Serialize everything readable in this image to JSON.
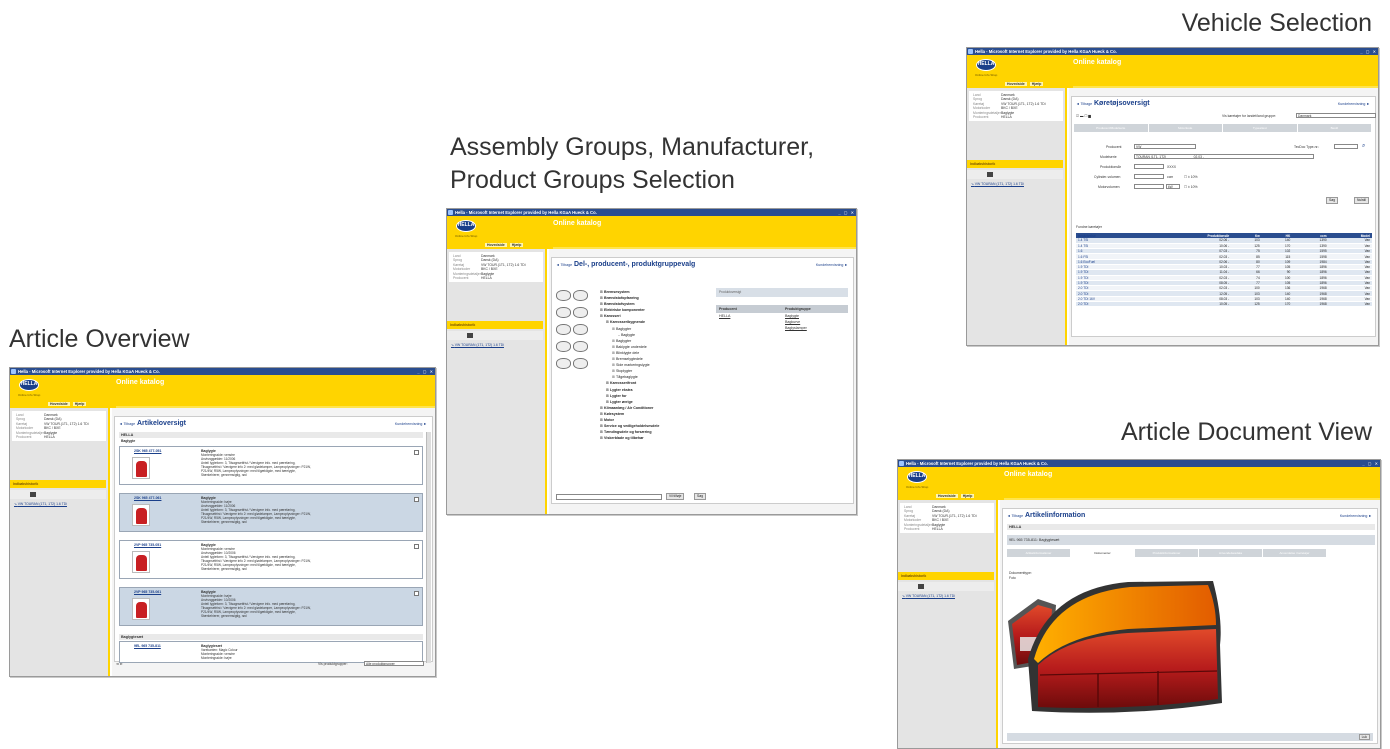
{
  "captions": {
    "vehicle": "Vehicle Selection",
    "assembly_line1": "Assembly Groups, Manufacturer,",
    "assembly_line2": "Product Groups Selection",
    "article": "Article Overview",
    "document": "Article Document View"
  },
  "common": {
    "window_title": "Hella - Microsoft Internet Explorer provided by Hella KGaA Hueck & Co.",
    "window_controls": "_ ▢ ✕",
    "logo_text": "HELLA",
    "logo_tagline": "Online Info Shop",
    "app_title": "Online katalog",
    "nav_home": "Hovedside",
    "nav_help": "Hjælp",
    "tabs": "Logning ud | Tilpasninger | Indkøbskurvoversigt | Vienhelt",
    "active_tab": "Vienhelt",
    "history_label": "Indkøbshistorik",
    "back_label": "Tilbage",
    "help_label": "Kundehenvisning",
    "context_keys": [
      "Land",
      "Sprog",
      "Køretøj",
      "Motorkoder",
      "Monteringsdetaljer",
      "Producent"
    ],
    "context_values": [
      "Danmark",
      "Dansk (DA)",
      "VW TOUR.(1T1, 1T2) 1.6 TDi",
      "BKC / BXE",
      "Baglygte",
      "HELLA"
    ],
    "history_link": "VW TOURAN (1T1, 1T2) 1.6 TDi"
  },
  "vehicle": {
    "page_title": "Køretøjsoversigt",
    "country_label": "Vis køretøjer for landet/land gruppe:",
    "country_value": "Danmark",
    "tabs": [
      "Producent/Modelserie",
      "Motorkode",
      "Typeattest",
      "Bestil"
    ],
    "producer_label": "Producent",
    "producer_value": "VW",
    "tecdoc_label": "TecDoc Type-nr.:",
    "model_label": "Modelserie",
    "model_value": "TOURAN (1T1, 1T2)",
    "model_date": "02.03 - ",
    "year_label": "Produktionsår",
    "year_value": "XXXX",
    "ccm_label": "Cylinder-volumen",
    "ccm_unit": "ccm",
    "kw_label": "Motorvolumen",
    "kw_unit": "kW",
    "tolerance": "± 10%",
    "search_button": "Søg",
    "reset_button": "Nulstil",
    "result_label": "Fundne køretøjer",
    "result_headers": [
      "Beskrivelse",
      "Produktionsår",
      "Kw",
      "HK",
      "ccm",
      "Model"
    ],
    "results": [
      [
        "1.4 TSI",
        "02.06 -",
        "103",
        "140",
        "1390",
        "Van"
      ],
      [
        "1.4 TSI",
        "10.06 -",
        "125",
        "170",
        "1390",
        "Van"
      ],
      [
        "1.6",
        "07.03 -",
        "75",
        "102",
        "1595",
        "Van"
      ],
      [
        "1.6 FSI",
        "02.03 -",
        "85",
        "115",
        "1598",
        "Van"
      ],
      [
        "1.6 EcoFuel",
        "02.06 -",
        "80",
        "109",
        "1984",
        "Van"
      ],
      [
        "1.9 TDI",
        "10.03 -",
        "77",
        "105",
        "1896",
        "Van"
      ],
      [
        "1.9 TDI",
        "11.04 -",
        "66",
        "90",
        "1896",
        "Van"
      ],
      [
        "1.9 TDI",
        "02.03 -",
        "74",
        "100",
        "1896",
        "Van"
      ],
      [
        "1.9 TDI",
        "08.05 -",
        "77",
        "105",
        "1896",
        "Van"
      ],
      [
        "2.0 TDI",
        "02.03 -",
        "100",
        "136",
        "1968",
        "Van"
      ],
      [
        "2.0 TDI",
        "12.05 -",
        "103",
        "140",
        "1968",
        "Van"
      ],
      [
        "2.0 TDI 16V",
        "08.03 -",
        "103",
        "140",
        "1968",
        "Van"
      ],
      [
        "2.0 TDI",
        "10.05 -",
        "125",
        "170",
        "1968",
        "Van"
      ]
    ]
  },
  "assembly": {
    "page_title": "Del-, producent-, produktgruppevalg",
    "tree": [
      [
        "l1",
        "Bremsesystem"
      ],
      [
        "l1",
        "Brændstofopfanring"
      ],
      [
        "l1",
        "Brændstofsystem"
      ],
      [
        "l1",
        "Elektriske komponenter"
      ],
      [
        "l1",
        "Karosseri"
      ],
      [
        "l2",
        "Karrosseribygnende"
      ],
      [
        "l3",
        "Baglygter"
      ],
      [
        "l4",
        "Baglygte"
      ],
      [
        "l3",
        "Baglygter"
      ],
      [
        "l3",
        "Baklygte underdele"
      ],
      [
        "l3",
        "Blinklygte dele"
      ],
      [
        "l3",
        "Bremselygtedele"
      ],
      [
        "l3",
        "Side markeringslygte"
      ],
      [
        "l3",
        "Stoplygter"
      ],
      [
        "l3",
        "Tågebaglygte"
      ],
      [
        "l2",
        "Karrosserifront"
      ],
      [
        "l2",
        "Lygter ekstra"
      ],
      [
        "l2",
        "Lygter for"
      ],
      [
        "l2",
        "Lygter øvrige"
      ],
      [
        "l1",
        "Klimaanlæg / Air Conditioner"
      ],
      [
        "l1",
        "Kølesystem"
      ],
      [
        "l1",
        "Motor"
      ],
      [
        "l1",
        "Service og vedligeholdelsesdele"
      ],
      [
        "l1",
        "Tændingsdele og forsæring"
      ],
      [
        "l1",
        "Viskerblade og tilbehør"
      ]
    ],
    "prod_header": "Produktoversigt",
    "prod_col1": "Producent",
    "prod_col2": "Produktgruppe",
    "prod_producer": "HELLA",
    "prod_groups": [
      "Baglygte",
      "Bagkurve",
      "Baglyslamper"
    ],
    "button_continue": "Vil tilføje",
    "button_search": "Søg"
  },
  "article": {
    "page_title": "Artikeloversigt",
    "section1": "HELLA",
    "section_sub": "Baglygte",
    "section2": "Baglygtesæt",
    "items": [
      {
        "no": "2SK 965 477-051",
        "title": "Baglygte",
        "lines": [
          "Monteringsside: venstre",
          "Anvisnggælder: 11/2006",
          "Anteil lygteform: 3, Tilsagnsetfrist / Vævigere info. med pæreføring,",
          "Tilsagnsetfrist / Vævigere info 2: med glødelamper, Lampeoplysninger: P21W,",
          "P21/4W, R5W, Lampeoplysninger: med tilgældigde, med bæelygte,",
          "Stærkehierer, gennemsigtig, rød"
        ]
      },
      {
        "no": "2SK 965 477-061",
        "title": "Baglygte",
        "lines": [
          "Monteringsside: højre",
          "Anvisnggælder: 11/2006",
          "Anteil lygteform: 3, Tilsagnsetfrist / Vævigere info. med pæreføring,",
          "Tilsagnsetfrist / Vævigere info 2: med glødelamper, Lampeoplysninger: P21W,",
          "P21/4W, R5W, Lampeoplysninger: med tilgældigde, med bæelygte,",
          "Stærkehierer, gennemsigtig, rød"
        ]
      },
      {
        "no": "2VP 965 735-051",
        "title": "Baglygte",
        "lines": [
          "Monteringsside: venstre",
          "Anvisnggælder: 10/2006",
          "Anteil lygteform: 3, Tilsagnsetfrist / Vævigere info. med pæreføring,",
          "Tilsagnsetfrist / Vævigere info 2: med glødelamper, Lampeoplysninger: P21W,",
          "P21/4W, R5W, Lampeoplysninger: med tilgældigde, med bæelygte,",
          "Stærkehierer, gennemsigtig, rød"
        ]
      },
      {
        "no": "2VP 965 735-061",
        "title": "Baglygte",
        "lines": [
          "Monteringsside: højre",
          "Anvisnggælder: 10/2006",
          "Anteil lygteform: 3, Tilsagnsetfrist / Vævigere info. med pæreføring,",
          "Tilsagnsetfrist / Vævigere info 2: med glødelamper, Lampeoplysninger: P21W,",
          "P21/4W, R5W, Lampeoplysninger: med tilgældigde, med bæelygte,",
          "Stærkehierer, gennemsigtig, rød"
        ]
      }
    ],
    "set_item": {
      "no": "9EL 965 735-811",
      "title": "Baglygtesæt",
      "lines": [
        "Varekanten: Magic Colour",
        "Monteringsside: venstre",
        "Monteringsside: højre"
      ]
    },
    "footer_label": "Vis produktgrupper:",
    "footer_value": "Alle produktgrupper"
  },
  "document": {
    "page_title": "Artikelinformation",
    "section": "HELLA",
    "item": "9EL 965 735-811: Baglygtesæt",
    "tabs": [
      "Artikelinformationer",
      "Dokumenter",
      "Produktinformationer",
      "Anvendelsesdata",
      "Anvendelse i køretøjer"
    ],
    "doc_label": "Dokumenttype:",
    "doc_value": "Foto",
    "close_button": "Luk"
  },
  "colors": {
    "brand_yellow": "#ffd400",
    "brand_blue": "#1a3f8a",
    "table_header": "#2a4d8f"
  }
}
